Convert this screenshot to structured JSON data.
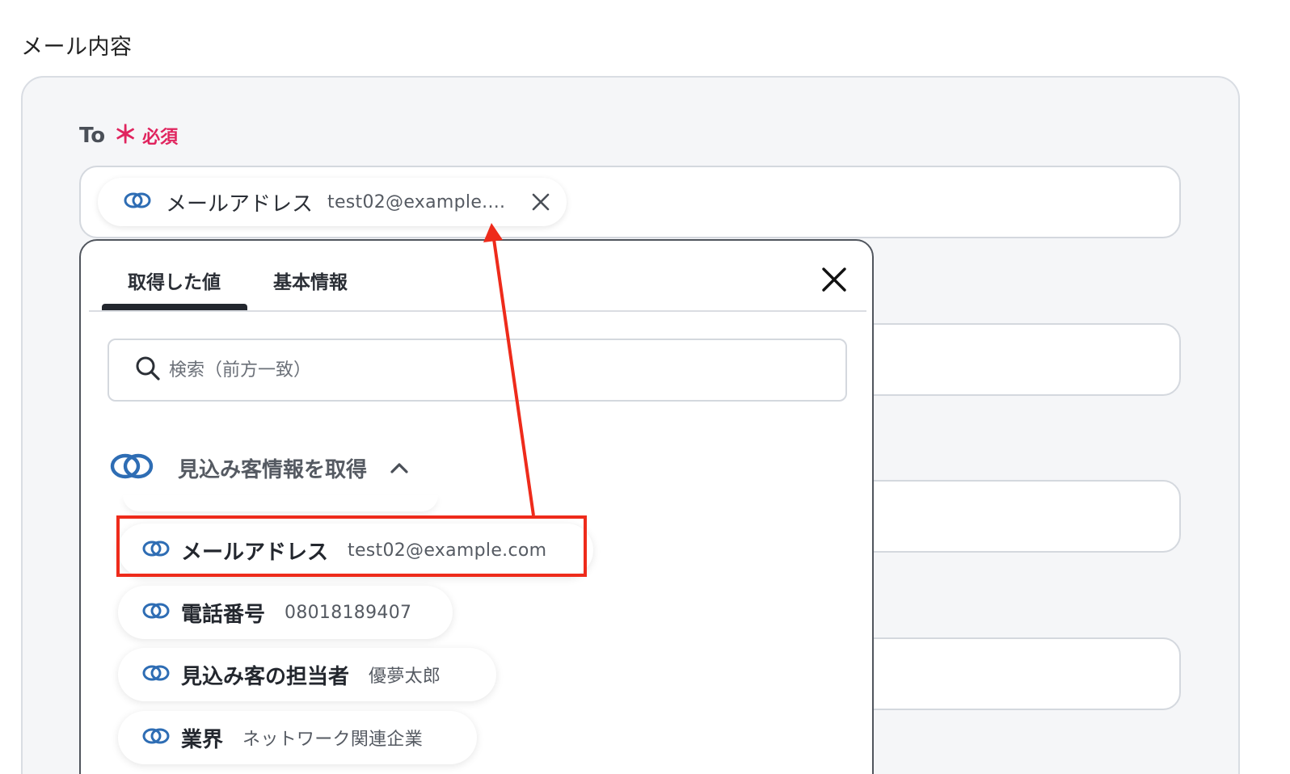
{
  "section_title": "メール内容",
  "to_field": {
    "label": "To",
    "required_mark": "＊",
    "required_text": "必須",
    "chip": {
      "icon": "link-rings-icon",
      "label": "メールアドレス",
      "value": "test02@example...."
    }
  },
  "dropdown": {
    "tabs": [
      {
        "label": "取得した値",
        "active": true
      },
      {
        "label": "基本情報",
        "active": false
      }
    ],
    "search": {
      "placeholder": "検索（前方一致）"
    },
    "group": {
      "title": "見込み客情報を取得",
      "expanded": true,
      "items": [
        {
          "label": "メールアドレス",
          "value": "test02@example.com",
          "highlighted": true
        },
        {
          "label": "電話番号",
          "value": "08018189407"
        },
        {
          "label": "見込み客の担当者",
          "value": "優夢太郎"
        },
        {
          "label": "業界",
          "value": "ネットワーク関連企業"
        }
      ]
    }
  },
  "colors": {
    "required": "#e0245e",
    "annotation": "#ee2b1b",
    "link_icon": "#2e6db4",
    "panel_bg": "#f5f6f8"
  }
}
